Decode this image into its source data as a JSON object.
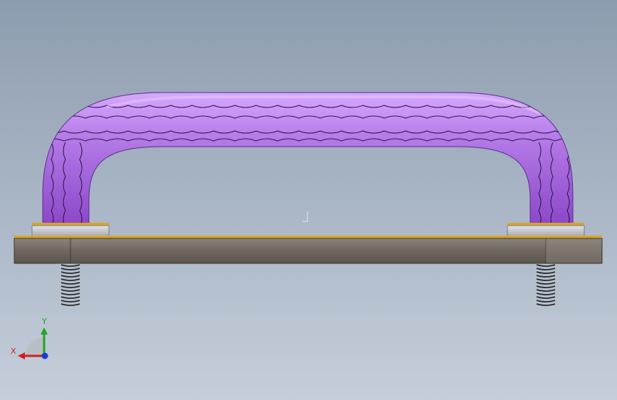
{
  "viewport": {
    "background_top": "#8d9cae",
    "background_bottom": "#c5ceda"
  },
  "model": {
    "handle_color": "#a868e0",
    "handle_highlight": "#d7a8ff",
    "handle_shadow": "#7a38b8",
    "base_plate_color": "#6e6860",
    "collar_color": "#c9c9cf",
    "accent_color": "#d6a52a",
    "spring_color": "#2a2a2a"
  },
  "triad": {
    "x_label": "X",
    "y_label": "Y",
    "x_color": "#d21f1f",
    "y_color": "#1fa51f",
    "z_color": "#1f3bd2"
  }
}
